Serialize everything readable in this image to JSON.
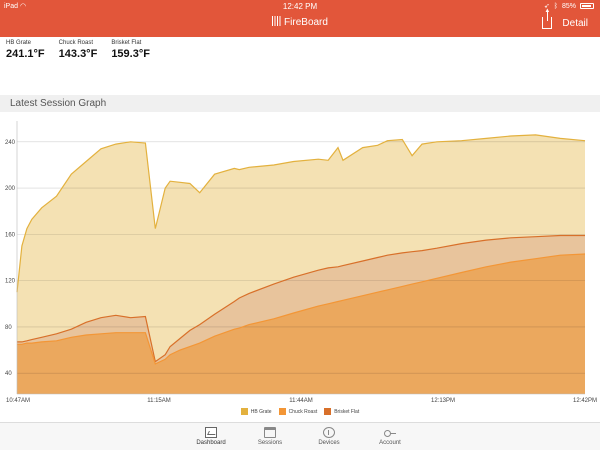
{
  "status_bar": {
    "device": "iPad",
    "time": "12:42 PM",
    "battery": "85%"
  },
  "header": {
    "app_name": "FireBoard",
    "detail_label": "Detail"
  },
  "readings": [
    {
      "label": "HB Grate",
      "value": "241.1°F"
    },
    {
      "label": "Chuck Roast",
      "value": "143.3°F"
    },
    {
      "label": "Brisket Flat",
      "value": "159.3°F"
    }
  ],
  "section_title": "Latest Session Graph",
  "chart_data": {
    "type": "area",
    "title": "",
    "xlabel": "",
    "ylabel": "",
    "x_tick_labels": [
      "10:47AM",
      "11:15AM",
      "11:44AM",
      "12:13PM",
      "12:42PM"
    ],
    "y_ticks": [
      40,
      80,
      120,
      160,
      200,
      240
    ],
    "ylim": [
      22,
      258
    ],
    "xlim_minutes_after_start": [
      0,
      115
    ],
    "grid": true,
    "legend_position": "bottom",
    "x": [
      0,
      1,
      2,
      3,
      5,
      8,
      11,
      14,
      17,
      20,
      23,
      26,
      28,
      30,
      31,
      33,
      35,
      37,
      40,
      44,
      45,
      47,
      52,
      56,
      61,
      63,
      65,
      66,
      70,
      73,
      75,
      78,
      80,
      82,
      85,
      90,
      95,
      100,
      105,
      110,
      115
    ],
    "series": [
      {
        "name": "HB Grate",
        "color": "#e3b13e",
        "fill": "#f4e1b3",
        "values": [
          110,
          150,
          165,
          173,
          183,
          193,
          212,
          223,
          234,
          238,
          240,
          239,
          165,
          200,
          206,
          205,
          204,
          196,
          212,
          217,
          216,
          218,
          220,
          223,
          225,
          224,
          235,
          224,
          235,
          237,
          241,
          242,
          228,
          238,
          240,
          241,
          243,
          245,
          246,
          243,
          241
        ]
      },
      {
        "name": "Chuck Roast",
        "color": "#f39636",
        "fill": "#eba85e",
        "values": [
          65,
          65,
          66,
          66,
          67,
          68,
          71,
          73,
          74,
          75,
          75,
          75,
          48,
          52,
          56,
          60,
          63,
          66,
          72,
          78,
          79,
          82,
          87,
          92,
          98,
          100,
          102,
          103,
          107,
          110,
          112,
          115,
          117,
          119,
          122,
          127,
          132,
          136,
          139,
          142,
          143
        ]
      },
      {
        "name": "Brisket Flat",
        "color": "#d8702a",
        "fill": "#e8c49c",
        "values": [
          67,
          67,
          68,
          69,
          71,
          74,
          78,
          84,
          88,
          90,
          88,
          89,
          50,
          56,
          63,
          70,
          77,
          82,
          91,
          102,
          105,
          109,
          117,
          123,
          129,
          131,
          132,
          133,
          137,
          140,
          142,
          144,
          145,
          146,
          148,
          152,
          155,
          157,
          158,
          159,
          159
        ]
      }
    ]
  },
  "tabs": [
    {
      "label": "Dashboard",
      "icon": "dashboard-icon"
    },
    {
      "label": "Sessions",
      "icon": "calendar-icon"
    },
    {
      "label": "Devices",
      "icon": "gauge-icon"
    },
    {
      "label": "Account",
      "icon": "key-icon"
    }
  ]
}
